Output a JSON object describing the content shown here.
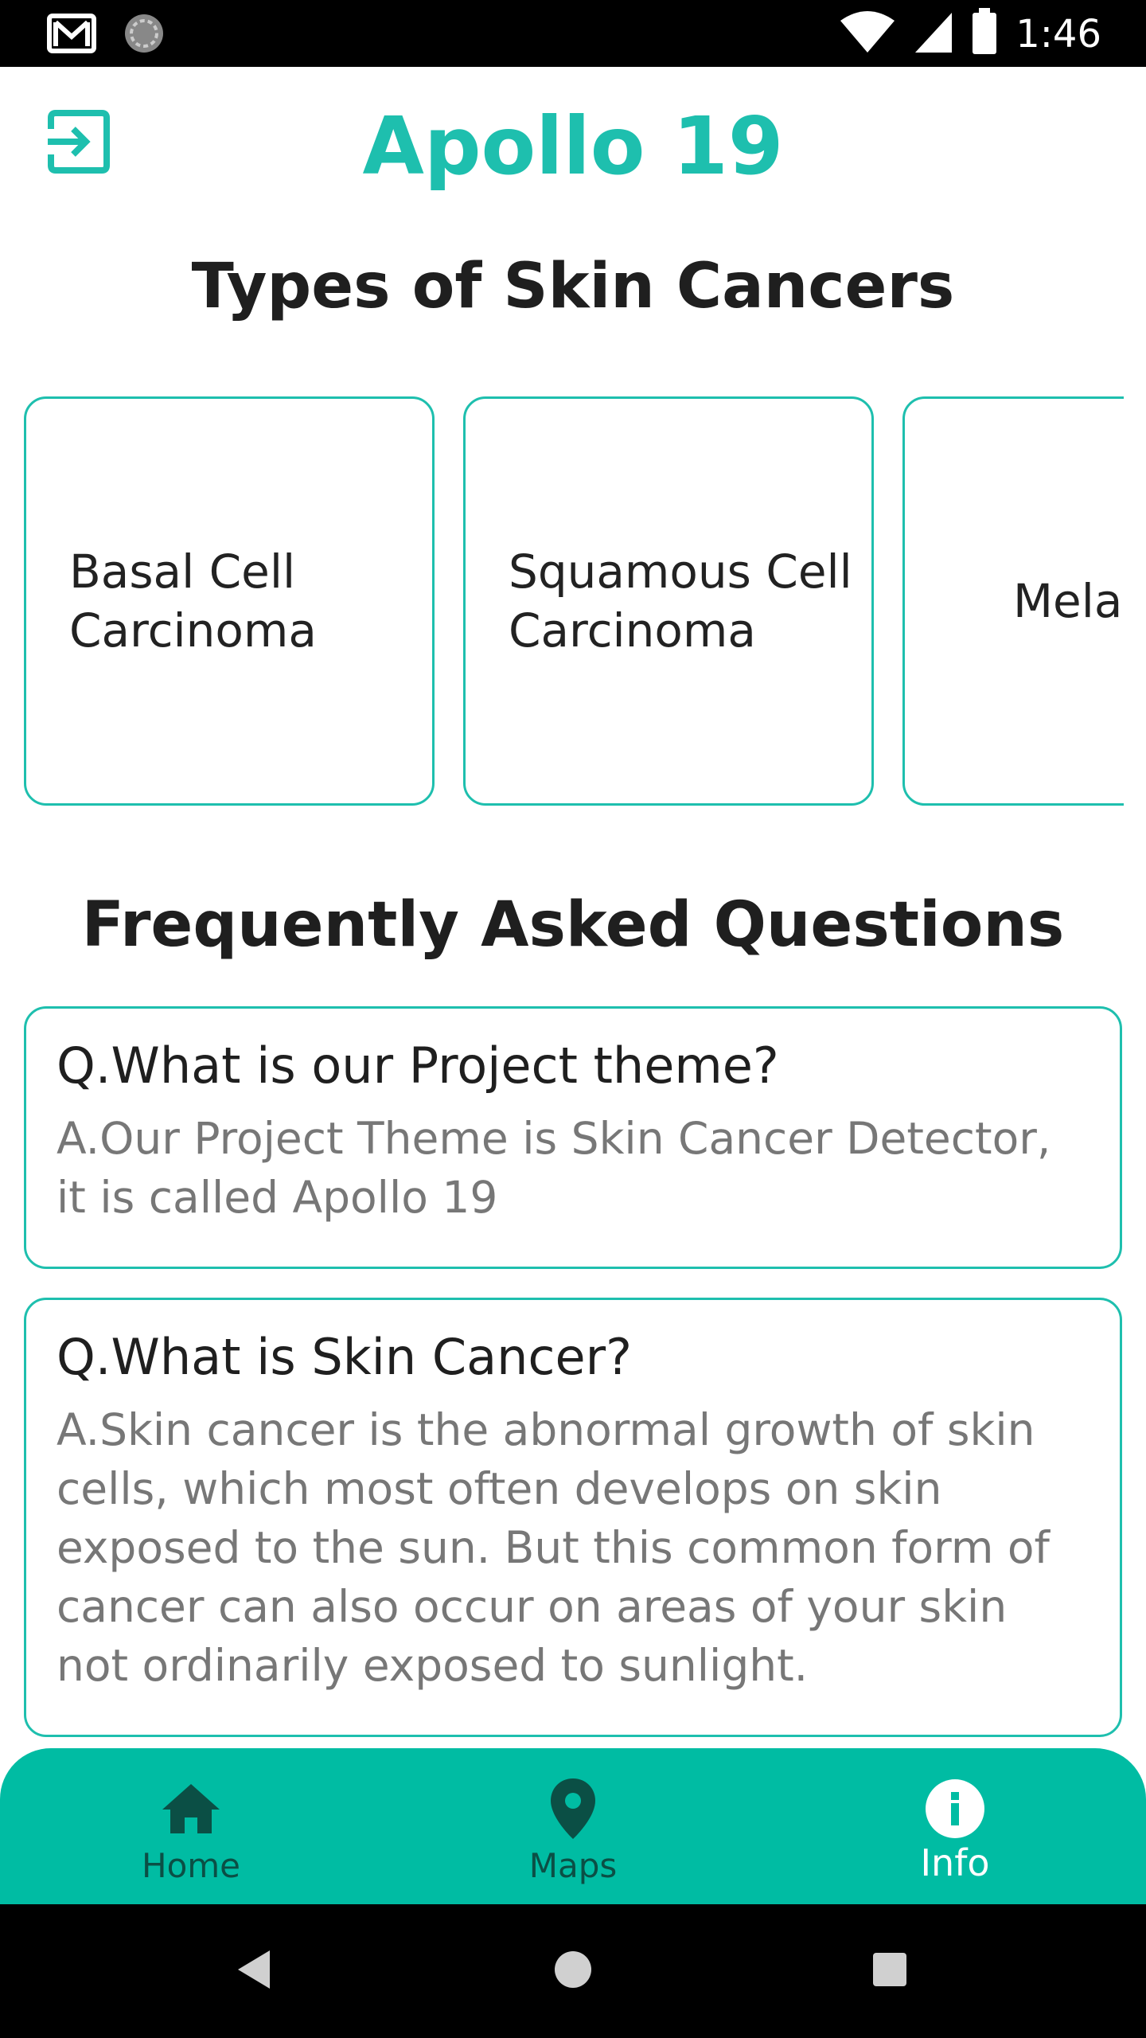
{
  "status_bar": {
    "time": "1:46",
    "left_icons": [
      "gmail-icon",
      "sync-icon"
    ],
    "right_icons": [
      "wifi-icon",
      "cell-signal-icon",
      "battery-icon"
    ]
  },
  "header": {
    "title": "Apollo 19",
    "logout_icon": "logout-icon"
  },
  "types_section": {
    "heading": "Types of Skin Cancers",
    "cards": [
      {
        "label": "Basal Cell Carcinoma"
      },
      {
        "label": "Squamous Cell Carcinoma"
      },
      {
        "label": "Mela"
      }
    ]
  },
  "faq_section": {
    "heading": "Frequently Asked Questions",
    "items": [
      {
        "question": "Q.What is our Project theme?",
        "answer": "A.Our Project Theme is Skin Cancer Detector, it is called Apollo 19"
      },
      {
        "question": "Q.What is Skin Cancer?",
        "answer": "A.Skin cancer is the abnormal growth of skin cells, which most often develops on skin exposed to the sun. But this common form of cancer can also occur on areas of your skin not ordinarily exposed to sunlight."
      }
    ]
  },
  "bottom_nav": {
    "items": [
      {
        "label": "Home",
        "icon": "home-icon",
        "active": false
      },
      {
        "label": "Maps",
        "icon": "map-pin-icon",
        "active": false
      },
      {
        "label": "Info",
        "icon": "info-icon",
        "active": true
      }
    ]
  },
  "colors": {
    "accent": "#1ebfae",
    "nav_background": "#00bca3",
    "nav_inactive": "#0b4f45",
    "nav_active": "#ffffff"
  }
}
